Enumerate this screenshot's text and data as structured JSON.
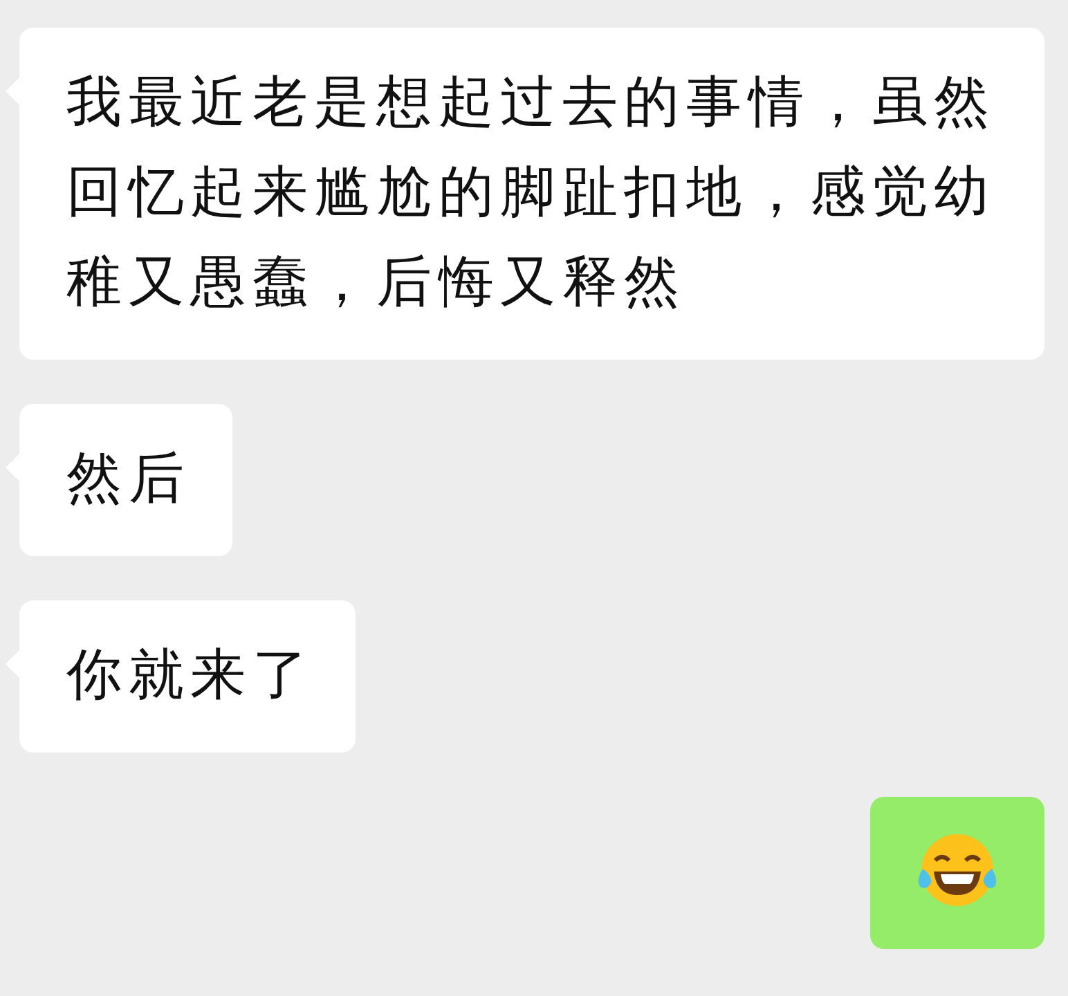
{
  "messages": [
    {
      "outgoing": false,
      "kind": "text",
      "text": "我最近老是想起过去的事情，虽然回忆起来尴尬的脚趾扣地，感觉幼稚又愚蠢，后悔又释然"
    },
    {
      "outgoing": false,
      "kind": "text",
      "text": "然后"
    },
    {
      "outgoing": false,
      "kind": "text",
      "text": "你就来了"
    },
    {
      "outgoing": true,
      "kind": "emoji"
    }
  ]
}
